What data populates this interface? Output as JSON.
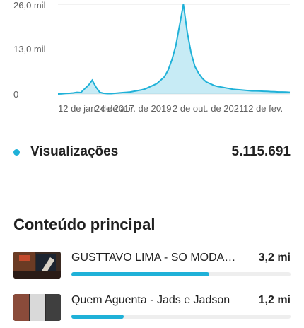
{
  "chart_data": {
    "type": "area",
    "y_ticks": [
      "26,0 mil",
      "13,0 mil",
      "0"
    ],
    "x_ticks": [
      "12 de jan. de 2017",
      "24 de abr. de 2019",
      "2 de out. de 2021",
      "12 de fev."
    ],
    "series": [
      {
        "values": [
          0,
          50,
          150,
          200,
          300,
          500,
          400,
          1500,
          2500,
          4000,
          2000,
          500,
          200,
          100,
          100,
          200,
          300,
          400,
          500,
          600,
          800,
          1000,
          1200,
          1500,
          2000,
          2500,
          3000,
          4000,
          5000,
          7000,
          10000,
          14000,
          20000,
          26000,
          18000,
          12000,
          8000,
          6000,
          4500,
          3500,
          3000,
          2500,
          2200,
          2000,
          1800,
          1600,
          1400,
          1300,
          1200,
          1100,
          1000,
          900,
          900,
          850,
          800,
          750,
          700,
          650,
          600,
          600,
          550,
          500
        ]
      }
    ],
    "ylim": [
      0,
      26000
    ],
    "color": "#1fb1d8",
    "grid": true
  },
  "metric": {
    "label": "Visualizações",
    "value": "5.115.691",
    "color": "#1fb1d8"
  },
  "section": {
    "title": "Conteúdo principal"
  },
  "items": [
    {
      "title": "GUSTTAVO LIMA - SO MODAO...",
      "value": "3,2 mi",
      "share": 0.63
    },
    {
      "title": "Quem Aguenta - Jads e Jadson",
      "value": "1,2 mi",
      "share": 0.24
    }
  ]
}
